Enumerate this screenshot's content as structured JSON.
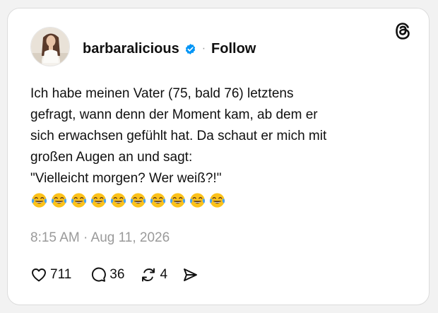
{
  "post": {
    "username": "barbaralicious",
    "separator": "·",
    "follow_label": "Follow",
    "text_lines": [
      "Ich habe meinen Vater (75, bald 76) letztens",
      "gefragt, wann denn der Moment kam, ab dem er",
      "sich erwachsen gefühlt hat. Da schaut er mich mit",
      "großen Augen an und sagt:",
      "\"Vielleicht morgen? Wer weiß?!\""
    ],
    "emoji": "face-with-tears-of-joy",
    "emoji_count": 10,
    "timestamp": "8:15 AM · Aug 11, 2026"
  },
  "actions": {
    "likes": "711",
    "replies": "36",
    "reposts": "4"
  },
  "icons": {
    "verified": "verified-badge-icon",
    "platform": "threads-logo-icon",
    "like": "heart-icon",
    "reply": "comment-bubble-icon",
    "repost": "repost-icon",
    "share": "send-icon"
  },
  "colors": {
    "verified_blue": "#0095f6",
    "text": "#101010",
    "muted": "#9a9a9a",
    "emoji_yellow": "#fcc21b"
  }
}
